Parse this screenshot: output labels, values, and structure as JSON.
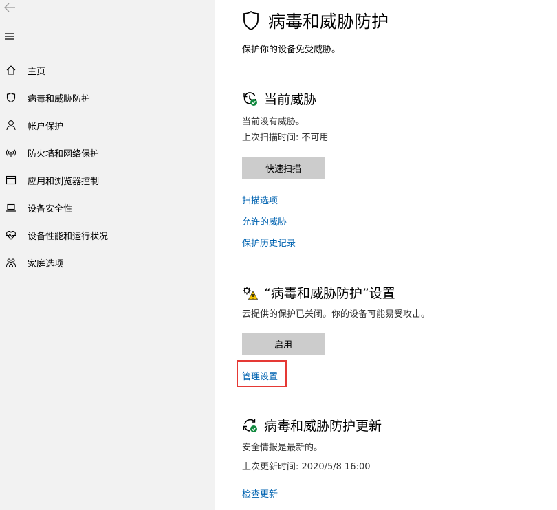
{
  "sidebar": {
    "items": [
      {
        "label": "主页",
        "icon": "home-icon"
      },
      {
        "label": "病毒和威胁防护",
        "icon": "shield-icon"
      },
      {
        "label": "帐户保护",
        "icon": "person-icon"
      },
      {
        "label": "防火墙和网络保护",
        "icon": "wifi-antenna-icon"
      },
      {
        "label": "应用和浏览器控制",
        "icon": "app-window-icon"
      },
      {
        "label": "设备安全性",
        "icon": "laptop-icon"
      },
      {
        "label": "设备性能和运行状况",
        "icon": "heart-pulse-icon"
      },
      {
        "label": "家庭选项",
        "icon": "family-icon"
      }
    ]
  },
  "page": {
    "title": "病毒和威胁防护",
    "subtitle": "保护你的设备免受威胁。"
  },
  "current_threats": {
    "title": "当前威胁",
    "status": "当前没有威胁。",
    "last_scan": "上次扫描时间: 不可用",
    "quick_scan_label": "快速扫描",
    "links": [
      "扫描选项",
      "允许的威胁",
      "保护历史记录"
    ]
  },
  "settings": {
    "title": "“病毒和威胁防护”设置",
    "status": "云提供的保护已关闭。你的设备可能易受攻击。",
    "enable_label": "启用",
    "manage_label": "管理设置"
  },
  "updates": {
    "title": "病毒和威胁防护更新",
    "status": "安全情报是最新的。",
    "last_update": "上次更新时间: 2020/5/8 16:00",
    "check_label": "检查更新"
  },
  "colors": {
    "sidebar_bg": "#f2f2f2",
    "link": "#0063b1",
    "button_bg": "#cccccc",
    "highlight": "#e53935",
    "ok_green": "#10893e",
    "warn_yellow": "#f7c600"
  }
}
